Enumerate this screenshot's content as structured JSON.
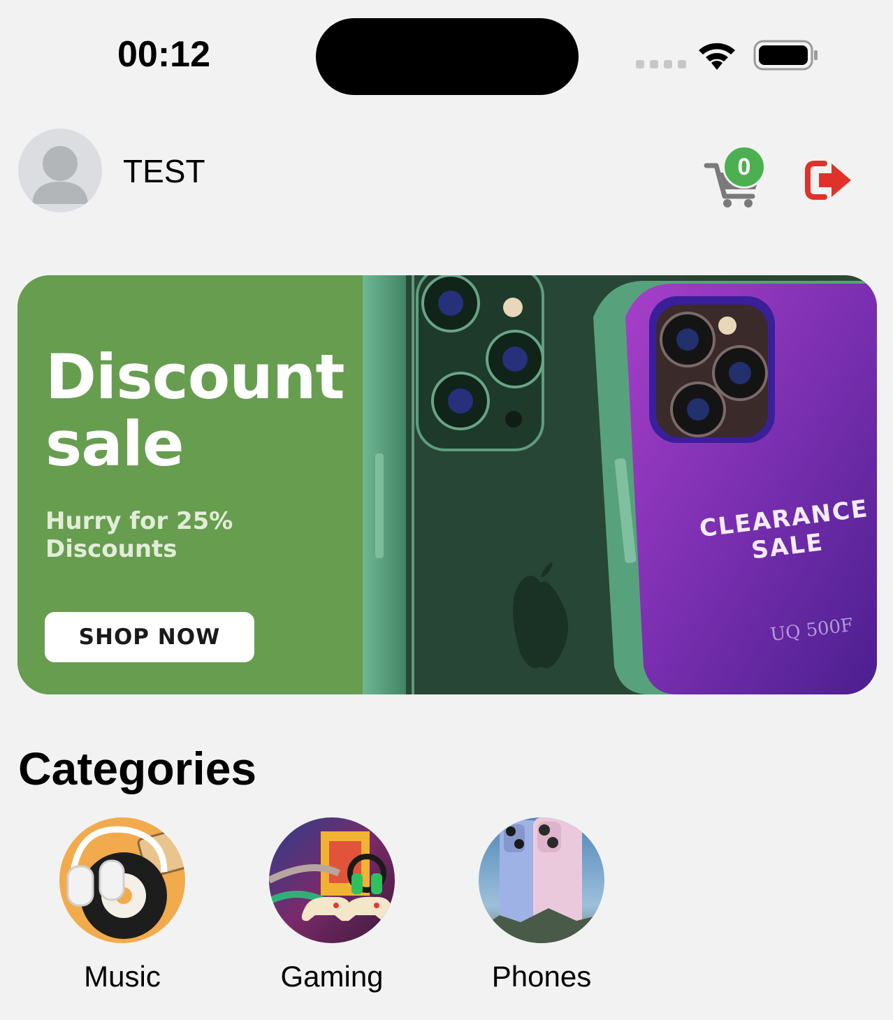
{
  "status_bar": {
    "time": "00:12",
    "icons": [
      "signal-dots-icon",
      "wifi-icon",
      "battery-icon"
    ]
  },
  "header": {
    "username": "TEST",
    "avatar_icon": "person-placeholder-icon",
    "cart_icon": "cart-icon",
    "cart_count": "0",
    "logout_icon": "logout-icon"
  },
  "banner": {
    "title": "Discount sale",
    "subtitle": "Hurry for 25% Discounts",
    "button_label": "SHOP NOW",
    "image_text_line1": "CLEARANCE",
    "image_text_line2": "SALE",
    "image_text_line3": "UQ 500F"
  },
  "categories": {
    "title": "Categories",
    "items": [
      {
        "label": "Music"
      },
      {
        "label": "Gaming"
      },
      {
        "label": "Phones"
      }
    ]
  },
  "colors": {
    "background": "#f2f2f2",
    "banner_green": "#679d4f",
    "badge_green": "#4cb050",
    "logout_red": "#e0322b"
  }
}
